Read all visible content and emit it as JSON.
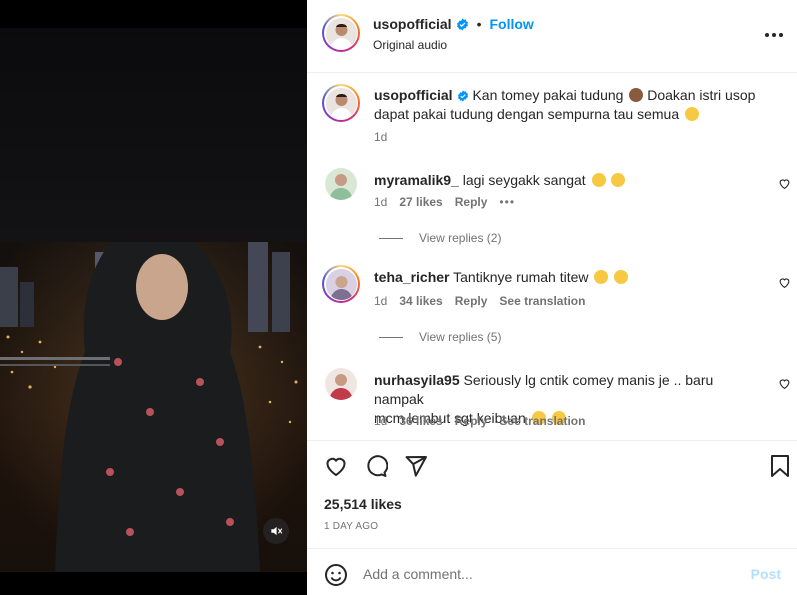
{
  "header": {
    "username": "usopofficial",
    "separator": "•",
    "follow_label": "Follow",
    "subtitle": "Original audio"
  },
  "caption": {
    "username": "usopofficial",
    "text_line1": "Kan tomey pakai tudung",
    "text_line1b": "Doakan istri usop",
    "text_line2": "dapat pakai tudung dengan sempurna tau semua",
    "time": "1d"
  },
  "comments": [
    {
      "username": "myramalik9_",
      "text": "lagi seygakk sangat",
      "time": "1d",
      "likes": "27 likes",
      "reply": "Reply",
      "extra": "•••",
      "view_replies": "View replies (2)"
    },
    {
      "username": "teha_richer",
      "text": "Tantiknye rumah titew",
      "time": "1d",
      "likes": "34 likes",
      "reply": "Reply",
      "extra": "See translation",
      "view_replies": "View replies (5)"
    },
    {
      "username": "nurhasyila95",
      "text_line1": "Seriously lg cntik comey manis je .. baru nampak",
      "text_line2": "mcm lembut sgt keibuan",
      "time": "1d",
      "likes": "36 likes",
      "reply": "Reply",
      "extra": "See translation"
    }
  ],
  "stats": {
    "likes": "25,514 likes",
    "posted": "1 DAY AGO"
  },
  "composer": {
    "placeholder": "Add a comment...",
    "post_label": "Post"
  },
  "icons": [
    "verified-icon",
    "more-icon",
    "heart-icon",
    "comment-icon",
    "share-icon",
    "save-icon",
    "emoji-icon",
    "mute-icon"
  ],
  "colors": {
    "accent": "#0095f6",
    "verified": "#0095f6",
    "post_disabled": "#b2dffc"
  }
}
